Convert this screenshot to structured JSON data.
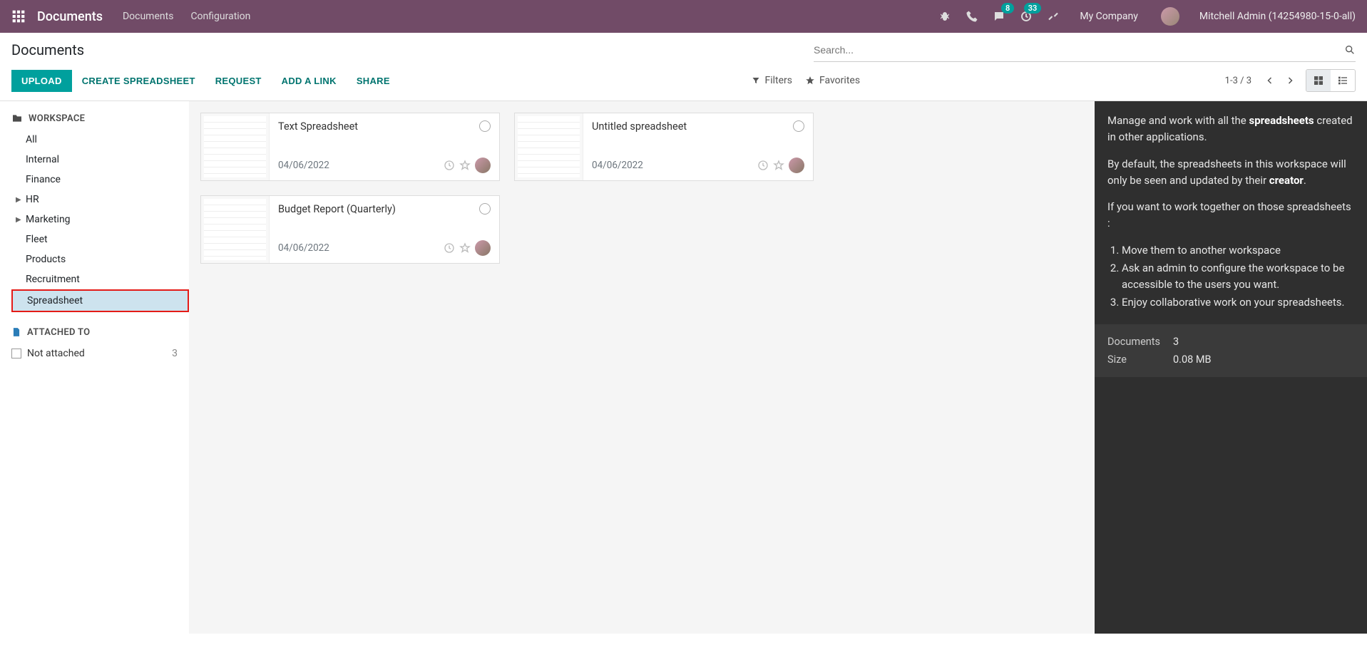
{
  "navbar": {
    "app_title": "Documents",
    "links": [
      "Documents",
      "Configuration"
    ],
    "msg_badge": "8",
    "activity_badge": "33",
    "company": "My Company",
    "username": "Mitchell Admin (14254980-15-0-all)"
  },
  "header": {
    "title": "Documents",
    "search_placeholder": "Search..."
  },
  "toolbar": {
    "upload": "UPLOAD",
    "create_spreadsheet": "CREATE SPREADSHEET",
    "request": "REQUEST",
    "add_link": "ADD A LINK",
    "share": "SHARE",
    "filters": "Filters",
    "favorites": "Favorites",
    "pager": "1-3 / 3"
  },
  "sidebar": {
    "workspace_label": "WORKSPACE",
    "items": [
      {
        "label": "All"
      },
      {
        "label": "Internal"
      },
      {
        "label": "Finance"
      },
      {
        "label": "HR",
        "caret": true
      },
      {
        "label": "Marketing",
        "caret": true
      },
      {
        "label": "Fleet"
      },
      {
        "label": "Products"
      },
      {
        "label": "Recruitment"
      },
      {
        "label": "Spreadsheet",
        "selected": true
      }
    ],
    "attached_label": "ATTACHED TO",
    "not_attached": "Not attached",
    "not_attached_count": "3"
  },
  "cards": [
    {
      "title": "Text Spreadsheet",
      "date": "04/06/2022"
    },
    {
      "title": "Untitled spreadsheet",
      "date": "04/06/2022"
    },
    {
      "title": "Budget Report (Quarterly)",
      "date": "04/06/2022"
    }
  ],
  "rightpanel": {
    "p1_pre": "Manage and work with all the ",
    "p1_strong": "spreadsheets",
    "p1_post": " created in other applications.",
    "p2_pre": "By default, the spreadsheets in this workspace will only be seen and updated by their ",
    "p2_strong": "creator",
    "p2_post": ".",
    "p3": "If you want to work together on those spreadsheets :",
    "li1": "Move them to another workspace",
    "li2": "Ask an admin to configure the workspace to be accessible to the users you want.",
    "li3": "Enjoy collaborative work on your spreadsheets.",
    "stats": {
      "documents_label": "Documents",
      "documents_value": "3",
      "size_label": "Size",
      "size_value": "0.08 MB"
    }
  }
}
